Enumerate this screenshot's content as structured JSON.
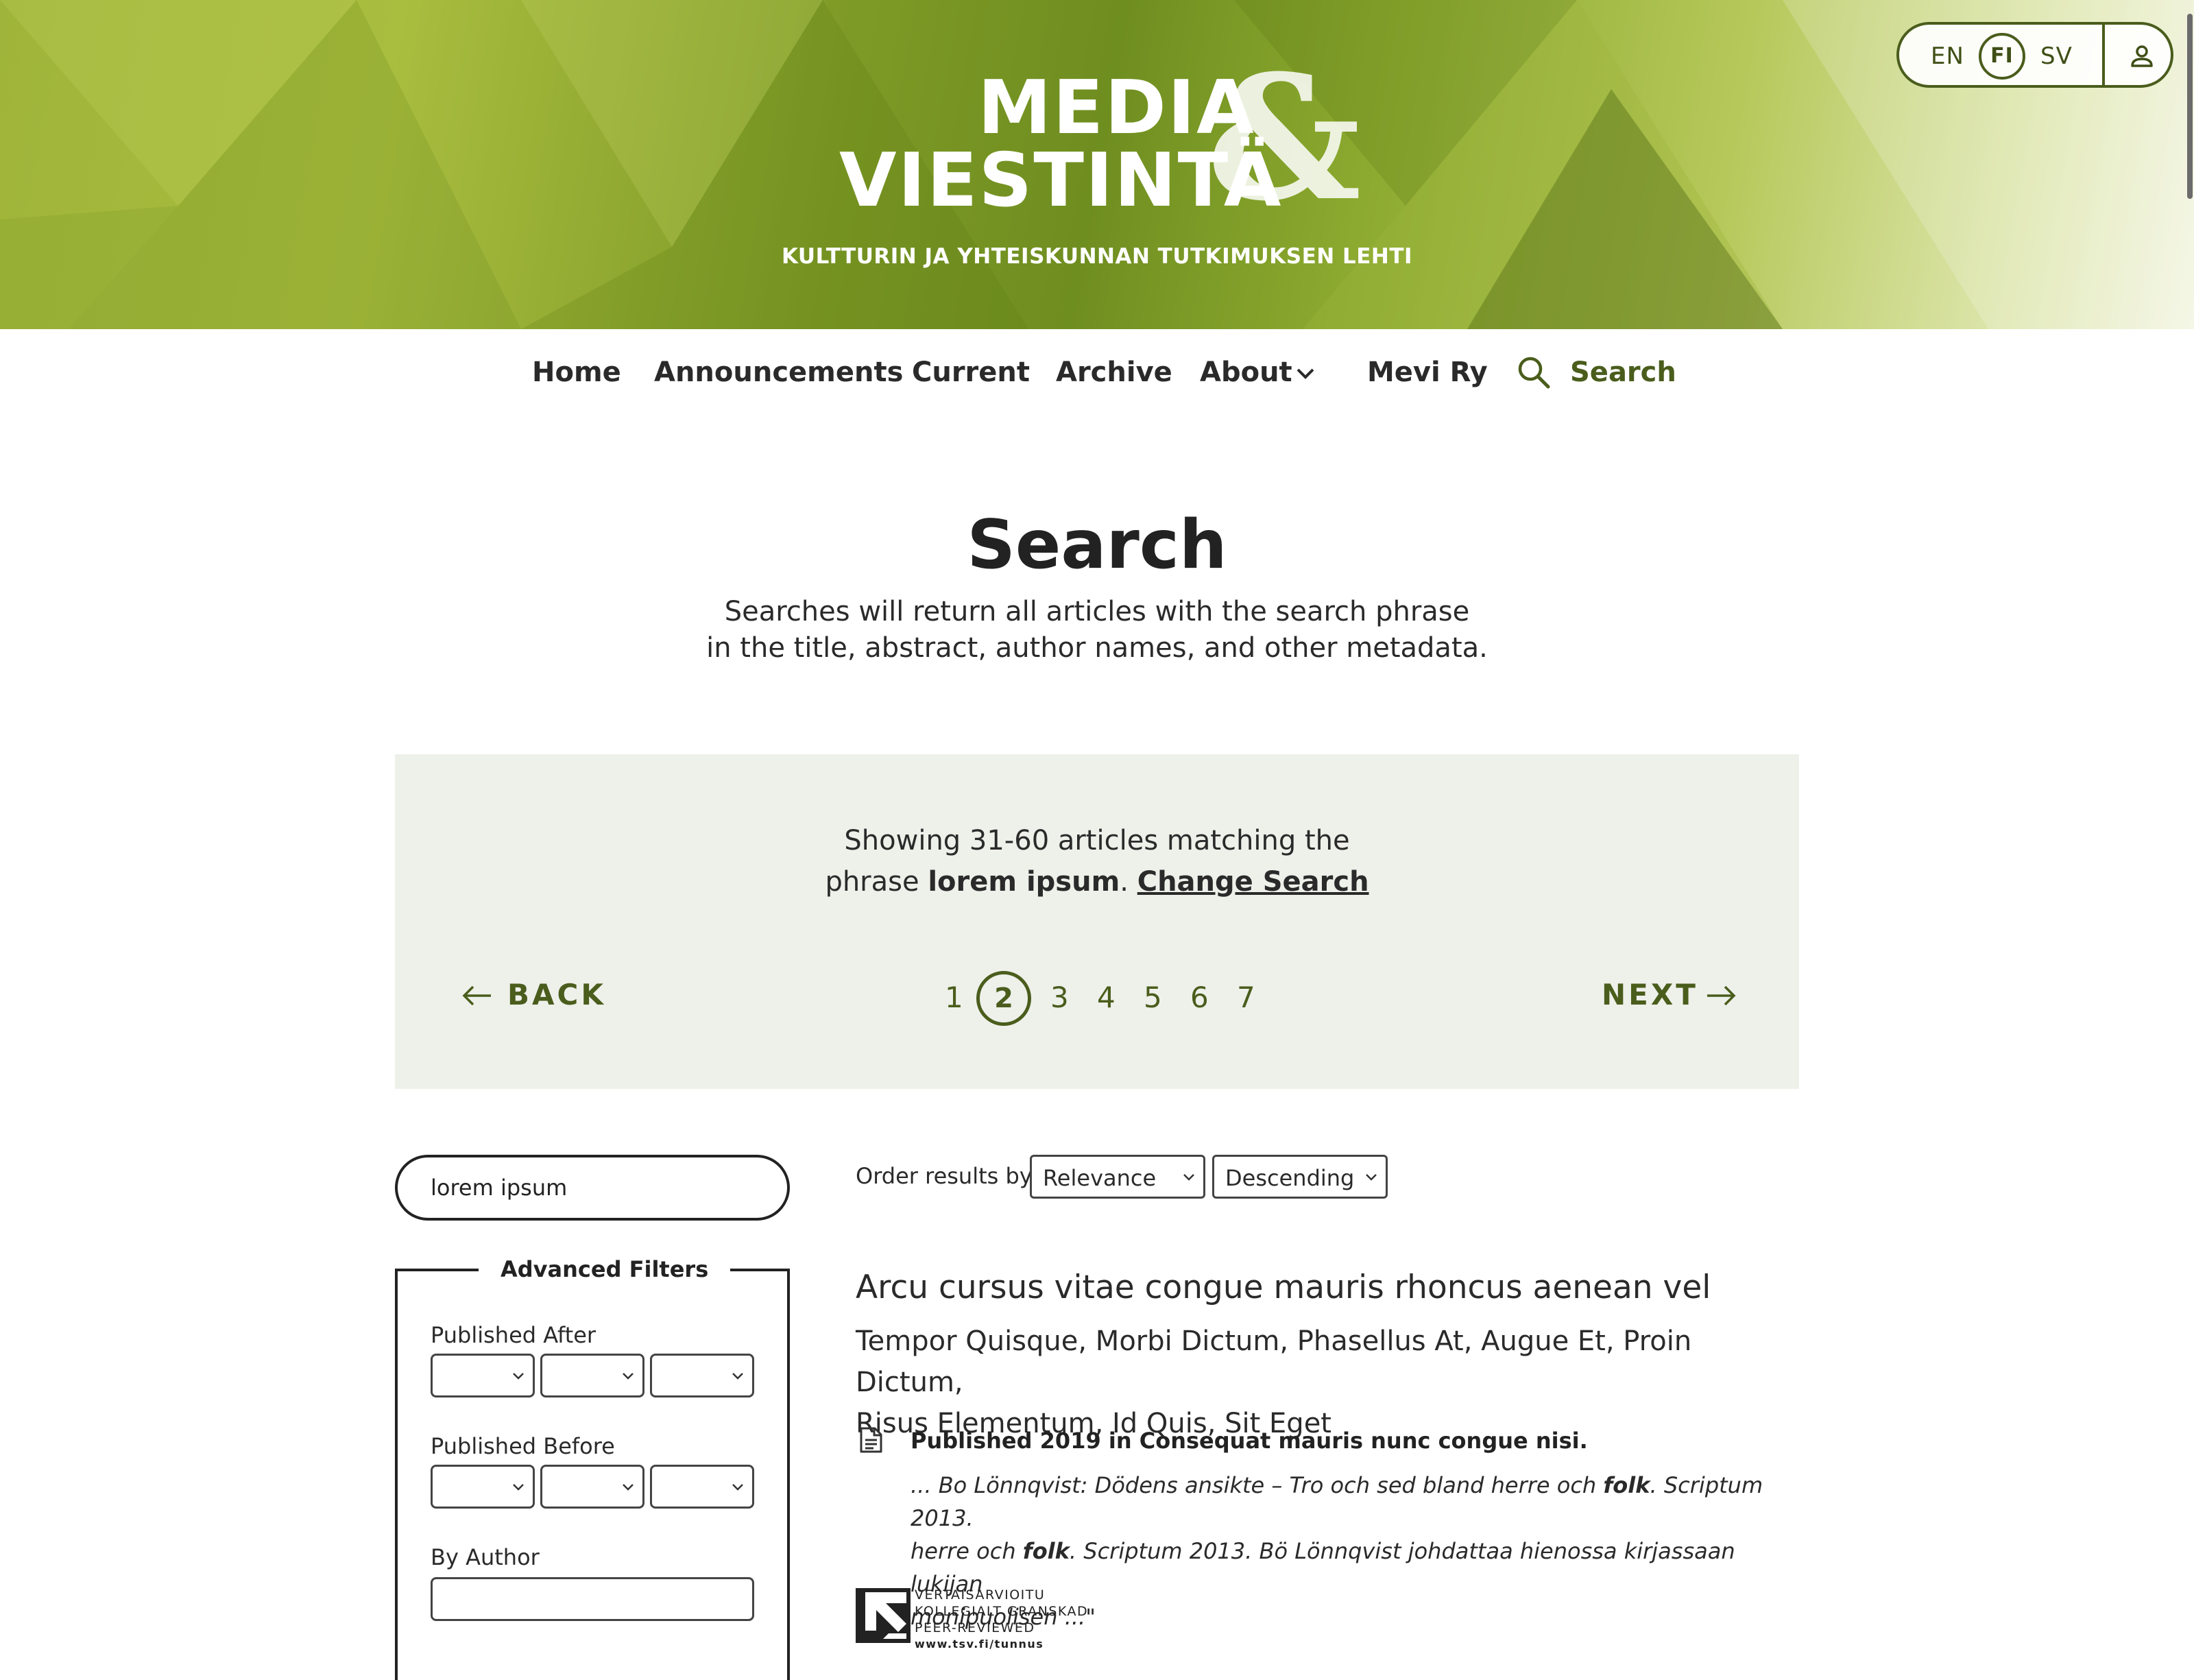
{
  "header": {
    "logo_line1": "MEDIA",
    "logo_line2": "VIESTINTÄ",
    "logo_amp": "&",
    "tagline": "KULTTURIN JA YHTEISKUNNAN TUTKIMUKSEN LEHTI",
    "languages": {
      "en": "EN",
      "fi": "FI",
      "sv": "SV",
      "current": "FI"
    },
    "user_icon": "user-icon"
  },
  "nav": {
    "home": "Home",
    "announcements": "Announcements",
    "current": "Current",
    "archive": "Archive",
    "about": "About",
    "mevi": "Mevi Ry",
    "search": "Search"
  },
  "page": {
    "title": "Search",
    "desc_line1": "Searches will return all articles with the search phrase",
    "desc_line2": "in the title, abstract, author names, and other metadata."
  },
  "results_summary": {
    "line1": "Showing 31-60 articles matching the",
    "prefix": "phrase",
    "phrase": "lorem ipsum",
    "period": ".",
    "change": "Change Search"
  },
  "pager": {
    "back": "BACK",
    "next": "NEXT",
    "pages": [
      "1",
      "2",
      "3",
      "4",
      "5",
      "6",
      "7"
    ],
    "current": 2
  },
  "sidebar": {
    "search_value": "lorem ipsum",
    "filters_title": "Advanced Filters",
    "published_after": "Published After",
    "published_before": "Published Before",
    "by_author": "By Author"
  },
  "order": {
    "label": "Order results by:",
    "by": "Relevance",
    "direction": "Descending"
  },
  "article": {
    "title": "Arcu cursus vitae congue mauris rhoncus aenean vel",
    "authors_line1": "Tempor Quisque, Morbi Dictum, Phasellus At, Augue Et, Proin Dictum,",
    "authors_line2": "Risus Elementum, Id Quis, Sit Eget",
    "published": "Published 2019 in Consequat mauris nunc congue nisi.",
    "snippet_1a": "... Bo Lönnqvist: Dödens ansikte – Tro och sed bland herre och ",
    "snippet_1b": "folk",
    "snippet_1c": ". Scriptum 2013.",
    "snippet_2a": "herre och ",
    "snippet_2b": "folk",
    "snippet_2c": ". Scriptum 2013. Bö Lönnqvist johdattaa hienossa kirjassaan lukijan",
    "snippet_3": "monipuolisen ...\"",
    "peer_line1": "VERTAISARVIOITU",
    "peer_line2": "KOLLEGIALT GRANSKAD",
    "peer_line3": "PEER-REVIEWED",
    "peer_line4": "www.tsv.fi/tunnus"
  },
  "colors": {
    "accent": "#4a5d1c",
    "panel_bg": "#eef0ea",
    "banner_green": "#8caa2f"
  }
}
